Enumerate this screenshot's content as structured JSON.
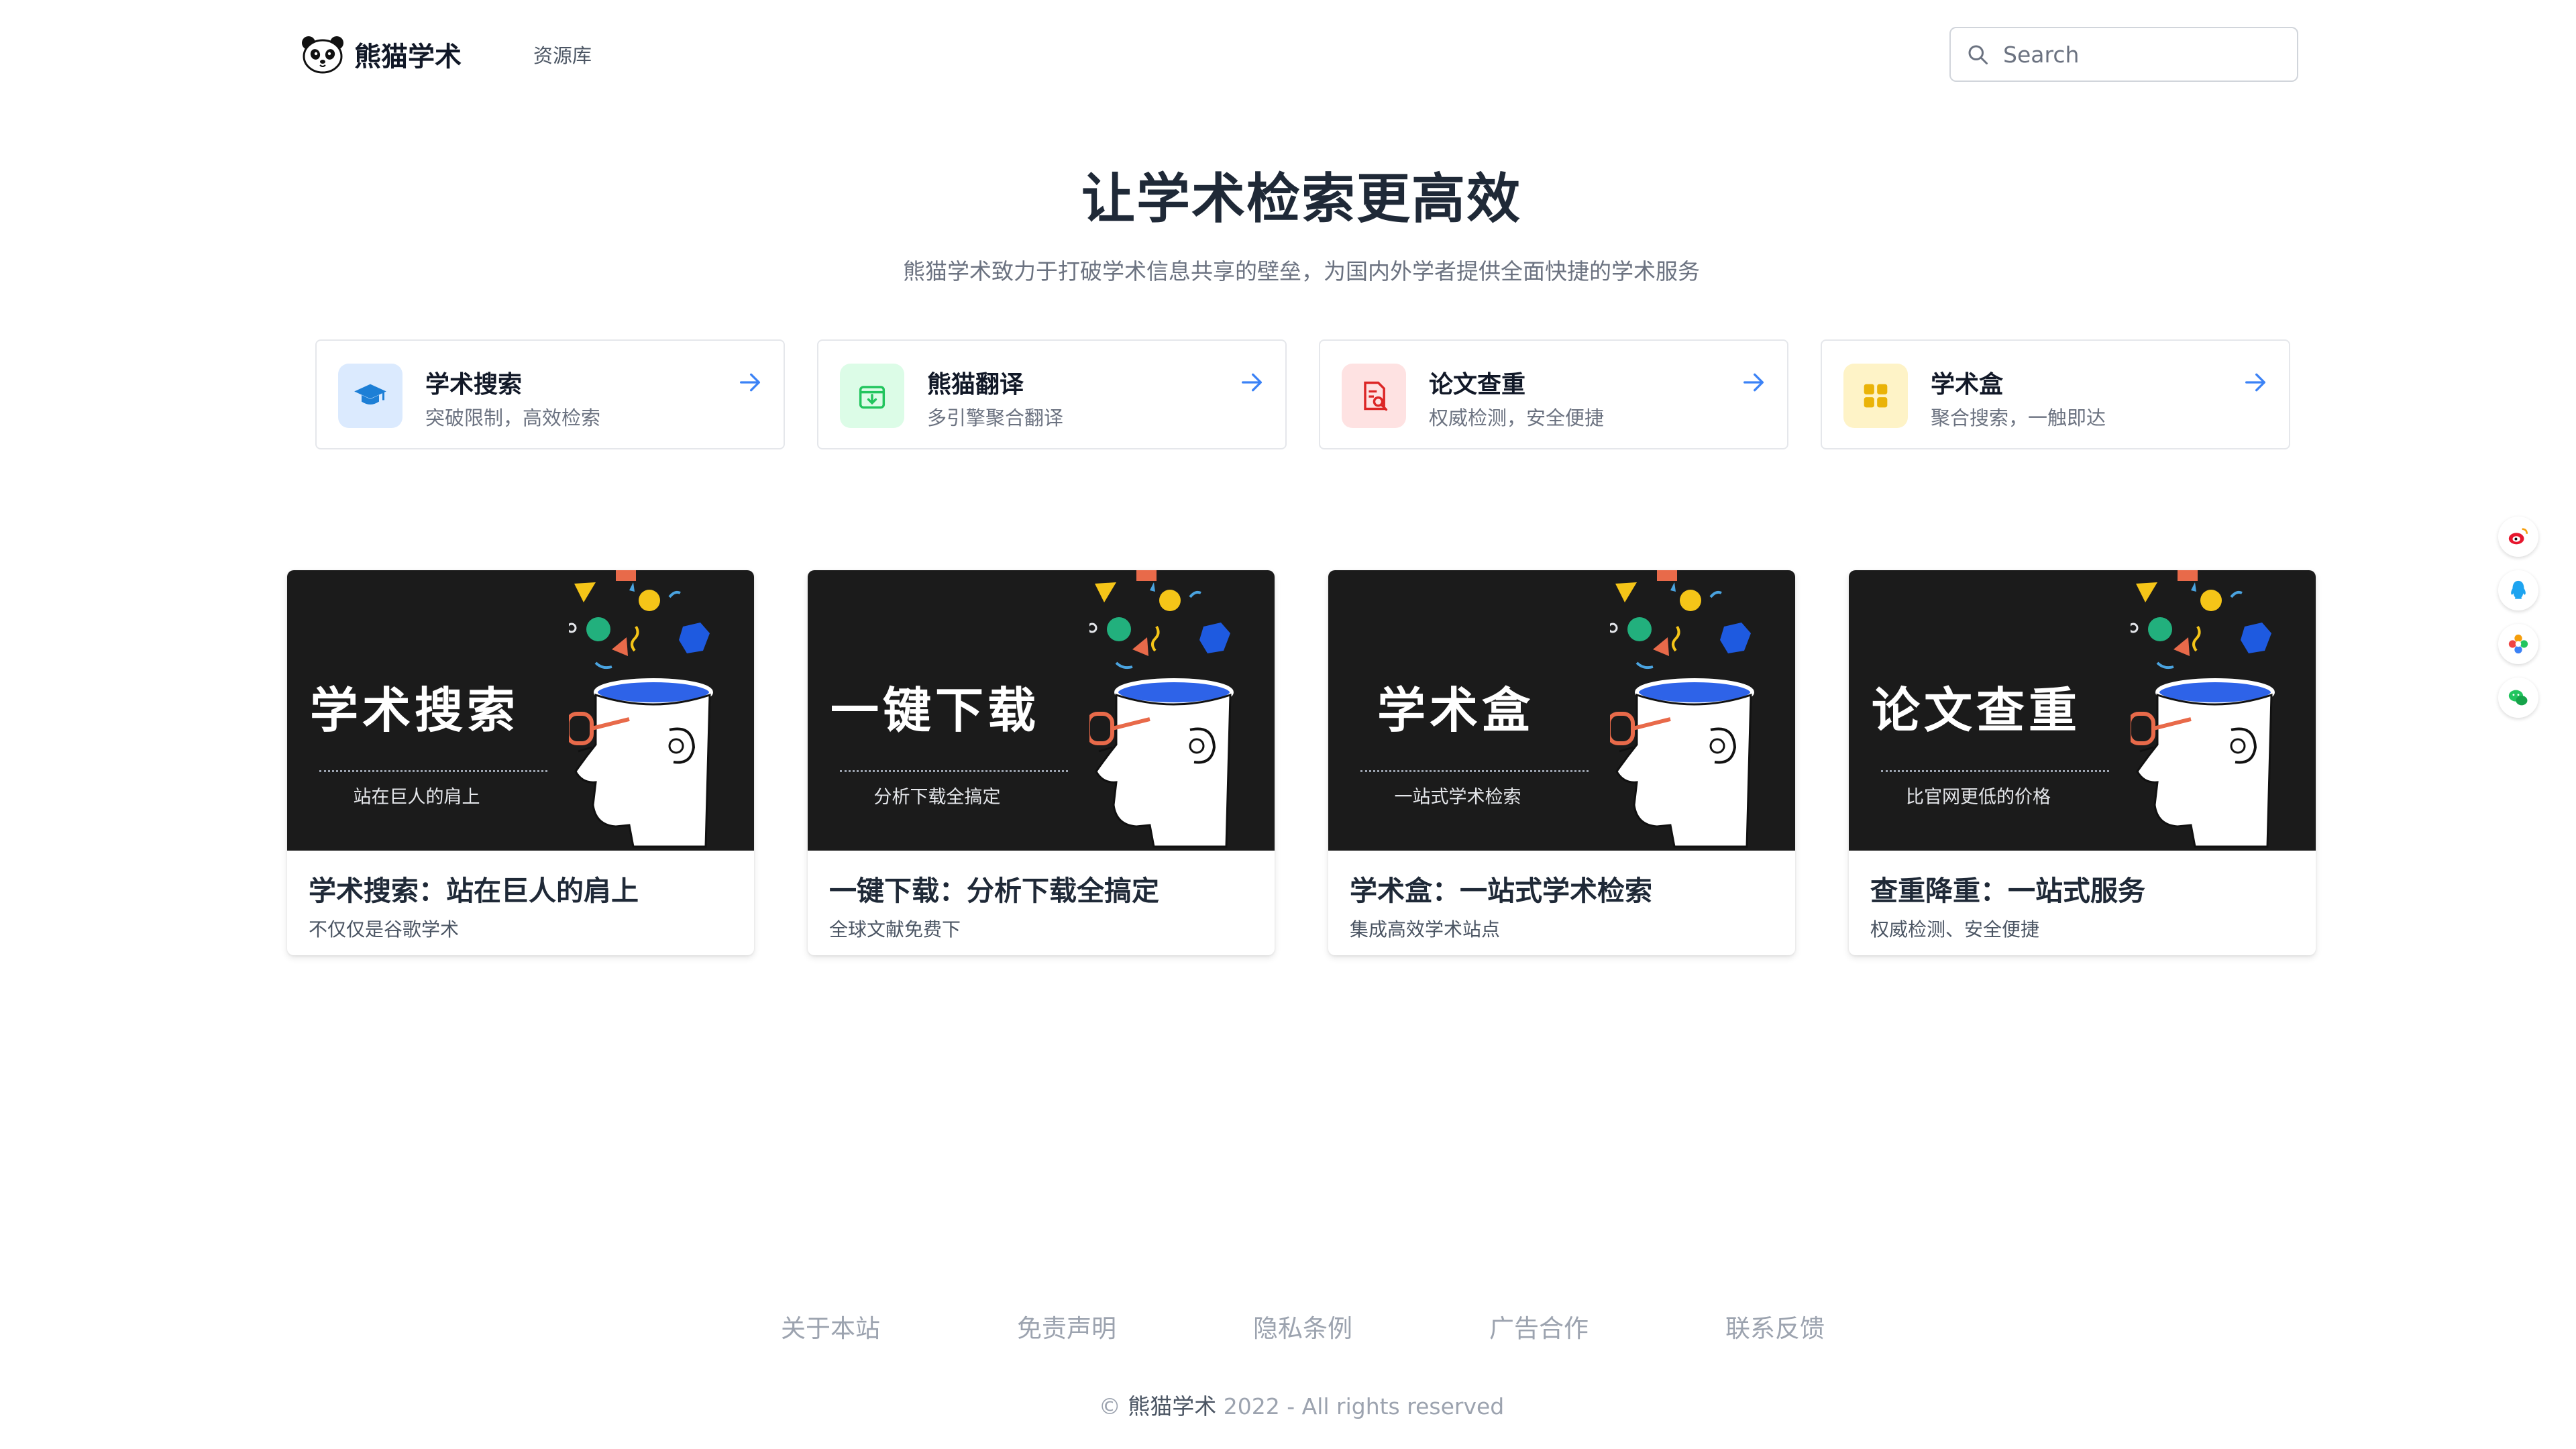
{
  "header": {
    "logo_text": "熊猫学术",
    "nav_link": "资源库",
    "search_placeholder": "Search"
  },
  "hero": {
    "title": "让学术检索更高效",
    "subtitle": "熊猫学术致力于打破学术信息共享的壁垒，为国内外学者提供全面快捷的学术服务"
  },
  "features": [
    {
      "title": "学术搜索",
      "desc": "突破限制，高效检索",
      "icon": "graduation-cap-icon",
      "color": "#3b82f6",
      "bg": "#dbeafe"
    },
    {
      "title": "熊猫翻译",
      "desc": "多引擎聚合翻译",
      "icon": "archive-download-icon",
      "color": "#22c55e",
      "bg": "#dcfce7"
    },
    {
      "title": "论文查重",
      "desc": "权威检测，安全便捷",
      "icon": "document-search-icon",
      "color": "#dc2626",
      "bg": "#fee2e2"
    },
    {
      "title": "学术盒",
      "desc": "聚合搜索，一触即达",
      "icon": "grid-icon",
      "color": "#eab308",
      "bg": "#fef3c7"
    }
  ],
  "cards": [
    {
      "banner_title": "学术搜索",
      "banner_sub": "站在巨人的肩上",
      "title": "学术搜索：站在巨人的肩上",
      "desc": "不仅仅是谷歌学术"
    },
    {
      "banner_title": "一键下载",
      "banner_sub": "分析下载全搞定",
      "title": "一键下载：分析下载全搞定",
      "desc": "全球文献免费下"
    },
    {
      "banner_title": "学术盒",
      "banner_sub": "一站式学术检索",
      "title": "学术盒：一站式学术检索",
      "desc": "集成高效学术站点"
    },
    {
      "banner_title": "论文查重",
      "banner_sub": "比官网更低的价格",
      "title": "查重降重：一站式服务",
      "desc": "权威检测、安全便捷"
    }
  ],
  "share_icons": [
    "weibo-icon",
    "qq-icon",
    "qzone-icon",
    "wechat-icon"
  ],
  "footer": {
    "links": [
      "关于本站",
      "免责声明",
      "隐私条例",
      "广告合作",
      "联系反馈"
    ],
    "copyright_prefix": "©",
    "copyright_brand": "熊猫学术",
    "copyright_suffix": "2022 - All rights reserved"
  }
}
